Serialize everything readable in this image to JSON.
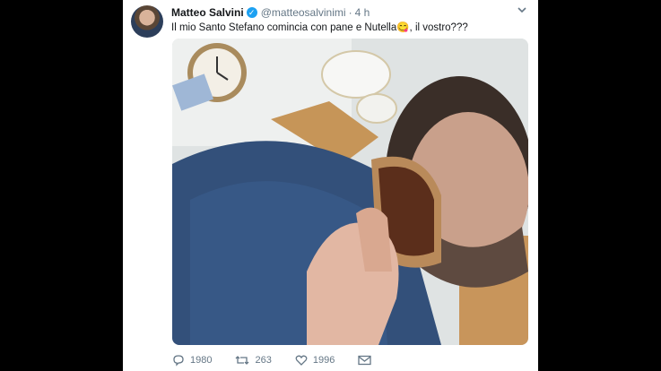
{
  "tweet": {
    "author_name": "Matteo Salvini",
    "handle": "@matteosalvinimi",
    "separator": "·",
    "time": "4 h",
    "text": "Il mio Santo Stefano comincia con pane e Nutella😋, il vostro???",
    "verified_icon": "verified-badge-icon",
    "menu_icon": "chevron-down-icon",
    "media": {
      "description_icon": "photo-icon"
    },
    "actions": {
      "replies": "1980",
      "retweets": "263",
      "likes": "1996"
    }
  },
  "colors": {
    "text_primary": "#14171a",
    "text_secondary": "#657786",
    "verified": "#1da1f2"
  }
}
